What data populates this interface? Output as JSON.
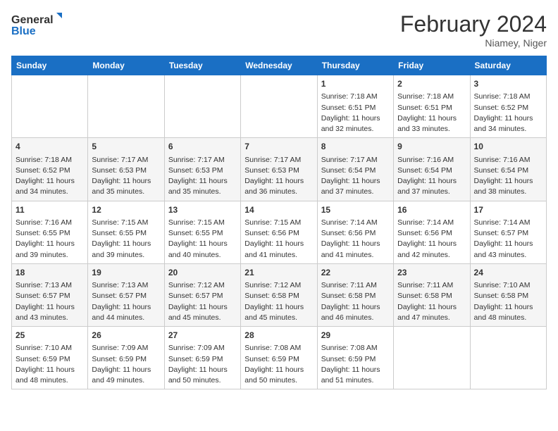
{
  "header": {
    "logo_general": "General",
    "logo_blue": "Blue",
    "month_title": "February 2024",
    "location": "Niamey, Niger"
  },
  "days_of_week": [
    "Sunday",
    "Monday",
    "Tuesday",
    "Wednesday",
    "Thursday",
    "Friday",
    "Saturday"
  ],
  "weeks": [
    [
      {
        "day": null
      },
      {
        "day": null
      },
      {
        "day": null
      },
      {
        "day": null
      },
      {
        "day": 1,
        "sunrise": "7:18 AM",
        "sunset": "6:51 PM",
        "daylight": "11 hours and 32 minutes."
      },
      {
        "day": 2,
        "sunrise": "7:18 AM",
        "sunset": "6:51 PM",
        "daylight": "11 hours and 33 minutes."
      },
      {
        "day": 3,
        "sunrise": "7:18 AM",
        "sunset": "6:52 PM",
        "daylight": "11 hours and 34 minutes."
      }
    ],
    [
      {
        "day": 4,
        "sunrise": "7:18 AM",
        "sunset": "6:52 PM",
        "daylight": "11 hours and 34 minutes."
      },
      {
        "day": 5,
        "sunrise": "7:17 AM",
        "sunset": "6:53 PM",
        "daylight": "11 hours and 35 minutes."
      },
      {
        "day": 6,
        "sunrise": "7:17 AM",
        "sunset": "6:53 PM",
        "daylight": "11 hours and 35 minutes."
      },
      {
        "day": 7,
        "sunrise": "7:17 AM",
        "sunset": "6:53 PM",
        "daylight": "11 hours and 36 minutes."
      },
      {
        "day": 8,
        "sunrise": "7:17 AM",
        "sunset": "6:54 PM",
        "daylight": "11 hours and 37 minutes."
      },
      {
        "day": 9,
        "sunrise": "7:16 AM",
        "sunset": "6:54 PM",
        "daylight": "11 hours and 37 minutes."
      },
      {
        "day": 10,
        "sunrise": "7:16 AM",
        "sunset": "6:54 PM",
        "daylight": "11 hours and 38 minutes."
      }
    ],
    [
      {
        "day": 11,
        "sunrise": "7:16 AM",
        "sunset": "6:55 PM",
        "daylight": "11 hours and 39 minutes."
      },
      {
        "day": 12,
        "sunrise": "7:15 AM",
        "sunset": "6:55 PM",
        "daylight": "11 hours and 39 minutes."
      },
      {
        "day": 13,
        "sunrise": "7:15 AM",
        "sunset": "6:55 PM",
        "daylight": "11 hours and 40 minutes."
      },
      {
        "day": 14,
        "sunrise": "7:15 AM",
        "sunset": "6:56 PM",
        "daylight": "11 hours and 41 minutes."
      },
      {
        "day": 15,
        "sunrise": "7:14 AM",
        "sunset": "6:56 PM",
        "daylight": "11 hours and 41 minutes."
      },
      {
        "day": 16,
        "sunrise": "7:14 AM",
        "sunset": "6:56 PM",
        "daylight": "11 hours and 42 minutes."
      },
      {
        "day": 17,
        "sunrise": "7:14 AM",
        "sunset": "6:57 PM",
        "daylight": "11 hours and 43 minutes."
      }
    ],
    [
      {
        "day": 18,
        "sunrise": "7:13 AM",
        "sunset": "6:57 PM",
        "daylight": "11 hours and 43 minutes."
      },
      {
        "day": 19,
        "sunrise": "7:13 AM",
        "sunset": "6:57 PM",
        "daylight": "11 hours and 44 minutes."
      },
      {
        "day": 20,
        "sunrise": "7:12 AM",
        "sunset": "6:57 PM",
        "daylight": "11 hours and 45 minutes."
      },
      {
        "day": 21,
        "sunrise": "7:12 AM",
        "sunset": "6:58 PM",
        "daylight": "11 hours and 45 minutes."
      },
      {
        "day": 22,
        "sunrise": "7:11 AM",
        "sunset": "6:58 PM",
        "daylight": "11 hours and 46 minutes."
      },
      {
        "day": 23,
        "sunrise": "7:11 AM",
        "sunset": "6:58 PM",
        "daylight": "11 hours and 47 minutes."
      },
      {
        "day": 24,
        "sunrise": "7:10 AM",
        "sunset": "6:58 PM",
        "daylight": "11 hours and 48 minutes."
      }
    ],
    [
      {
        "day": 25,
        "sunrise": "7:10 AM",
        "sunset": "6:59 PM",
        "daylight": "11 hours and 48 minutes."
      },
      {
        "day": 26,
        "sunrise": "7:09 AM",
        "sunset": "6:59 PM",
        "daylight": "11 hours and 49 minutes."
      },
      {
        "day": 27,
        "sunrise": "7:09 AM",
        "sunset": "6:59 PM",
        "daylight": "11 hours and 50 minutes."
      },
      {
        "day": 28,
        "sunrise": "7:08 AM",
        "sunset": "6:59 PM",
        "daylight": "11 hours and 50 minutes."
      },
      {
        "day": 29,
        "sunrise": "7:08 AM",
        "sunset": "6:59 PM",
        "daylight": "11 hours and 51 minutes."
      },
      {
        "day": null
      },
      {
        "day": null
      }
    ]
  ],
  "labels": {
    "sunrise": "Sunrise:",
    "sunset": "Sunset:",
    "daylight": "Daylight:"
  }
}
